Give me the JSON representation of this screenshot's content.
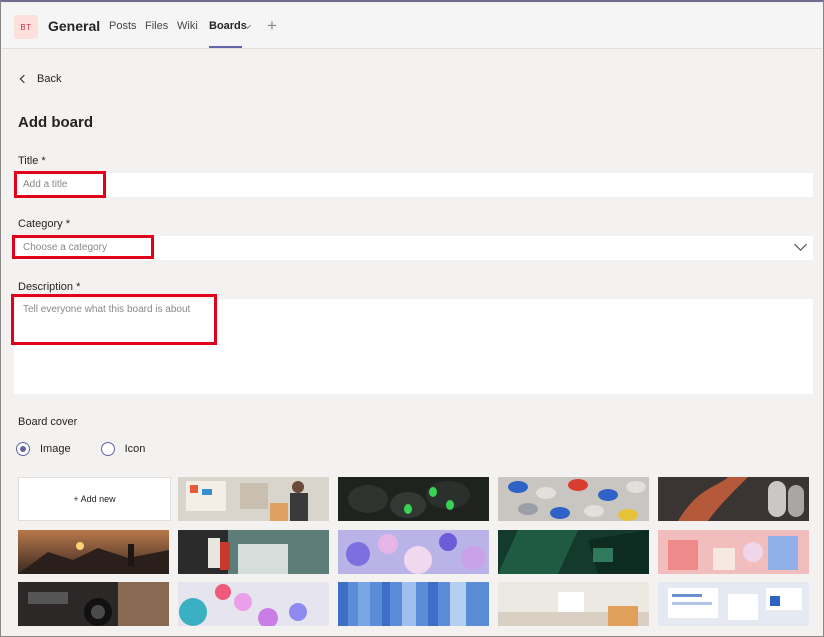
{
  "header": {
    "avatar_text": "BT",
    "channel_name": "General",
    "tabs": [
      {
        "label": "Posts"
      },
      {
        "label": "Files"
      },
      {
        "label": "Wiki"
      },
      {
        "label": "Boards",
        "active": true
      }
    ],
    "add_tab_icon": "plus-icon",
    "accent_color": "#6264a7"
  },
  "back": {
    "label": "Back",
    "icon": "chevron-left-icon"
  },
  "form": {
    "title_heading": "Add board",
    "title": {
      "label": "Title *",
      "placeholder": "Add a title",
      "value": ""
    },
    "category": {
      "label": "Category *",
      "placeholder": "Choose a category",
      "value": ""
    },
    "description": {
      "label": "Description *",
      "placeholder": "Tell everyone what this board is about",
      "value": ""
    }
  },
  "board_cover": {
    "label": "Board cover",
    "options": [
      {
        "label": "Image",
        "selected": true
      },
      {
        "label": "Icon",
        "selected": false
      }
    ],
    "add_new_label": "+ Add new",
    "image_count_visible": 14
  },
  "highlight_color": "#e3001b"
}
